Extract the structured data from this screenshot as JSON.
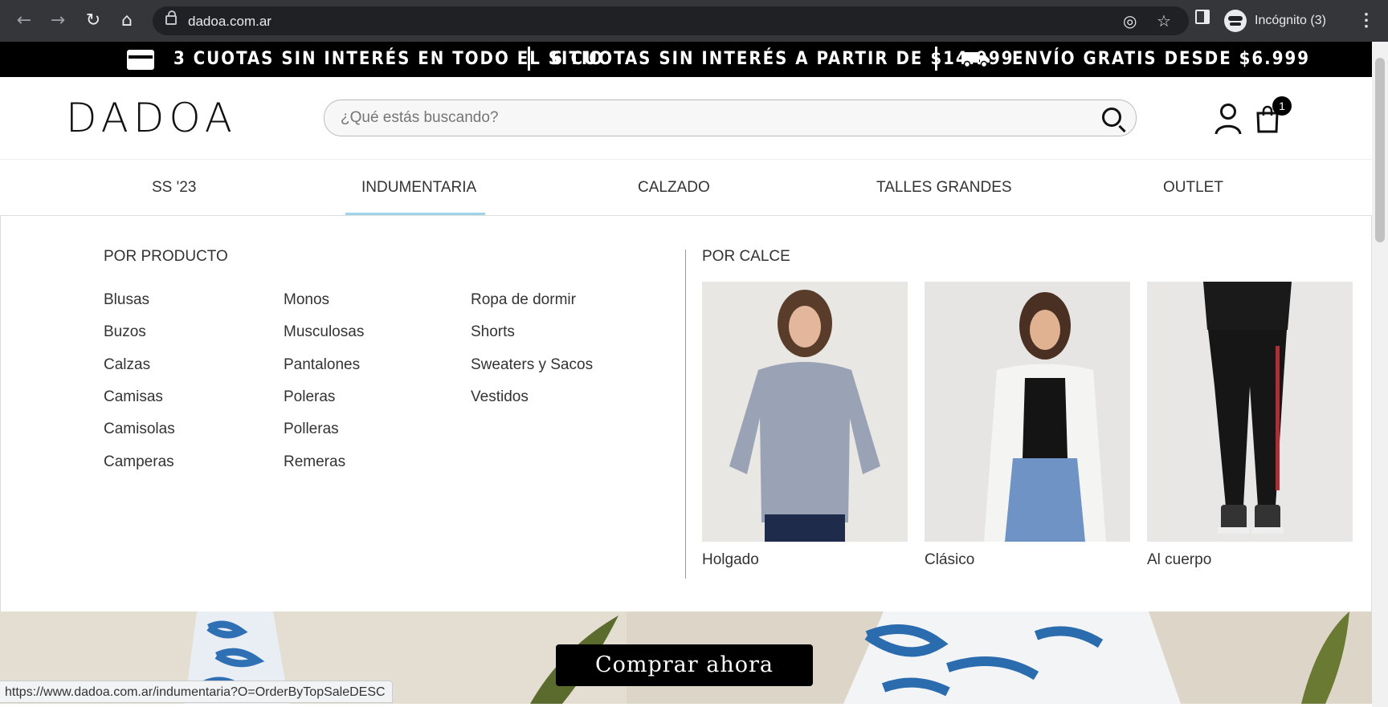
{
  "browser": {
    "url": "dadoa.com.ar",
    "profile_label": "Incógnito (3)",
    "status_url": "https://www.dadoa.com.ar/indumentaria?O=OrderByTopSaleDESC"
  },
  "promo": {
    "item1": "3 CUOTAS SIN INTERÉS EN TODO EL SITIO",
    "item2": "6 CUOTAS SIN INTERÉS A PARTIR DE $14.999",
    "item3": "ENVÍO GRATIS DESDE $6.999"
  },
  "header": {
    "logo": "DADOA",
    "search_placeholder": "¿Qué estás buscando?",
    "cart_count": "1"
  },
  "categories": [
    "SS '23",
    "INDUMENTARIA",
    "CALZADO",
    "TALLES GRANDES",
    "OUTLET"
  ],
  "dropdown": {
    "by_product_title": "POR PRODUCTO",
    "by_fit_title": "POR CALCE",
    "col1": [
      "Blusas",
      "Buzos",
      "Calzas",
      "Camisas",
      "Camisolas",
      "Camperas"
    ],
    "col2": [
      "Monos",
      "Musculosas",
      "Pantalones",
      "Poleras",
      "Polleras",
      "Remeras"
    ],
    "col3": [
      "Ropa de dormir",
      "Shorts",
      "Sweaters y Sacos",
      "Vestidos"
    ],
    "fits": [
      "Holgado",
      "Clásico",
      "Al cuerpo"
    ]
  },
  "hero": {
    "cta": "Comprar ahora"
  },
  "colors": {
    "chrome": "#35363a",
    "promo_bg": "#000000",
    "active_underline": "#9fd3e8"
  }
}
